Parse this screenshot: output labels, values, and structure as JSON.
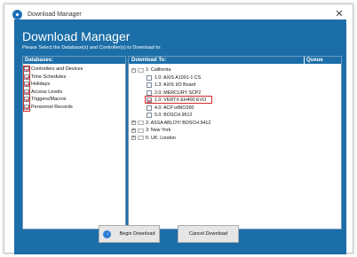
{
  "window": {
    "title": "Download Manager",
    "close_glyph": "✕"
  },
  "header": {
    "heading": "Download Manager",
    "subheading": "Please Select the Database(s) and Controller(s) to Download to:"
  },
  "databases": {
    "header": "Databases:",
    "items": [
      {
        "label": "Controllers and Devices",
        "checked": true
      },
      {
        "label": "Time Schedules",
        "checked": true
      },
      {
        "label": "Holidays",
        "checked": true
      },
      {
        "label": "Access Levels",
        "checked": true
      },
      {
        "label": "Triggers/Macros",
        "checked": true
      },
      {
        "label": "Personnel Records",
        "checked": true
      }
    ]
  },
  "download_to": {
    "header": "Download To:",
    "queue_header": "Queue",
    "tree": [
      {
        "label": "1: California",
        "level": 0,
        "expander": "−"
      },
      {
        "label": "1.0: AXIS A1001-1 CS",
        "level": 1,
        "checked": false
      },
      {
        "label": "1.3: AXIS I/O Board",
        "level": 1,
        "checked": false
      },
      {
        "label": "2.0: MERCURY SCP2",
        "level": 1,
        "checked": false
      },
      {
        "label": "1.0: VERTX EH400 EVO",
        "level": 1,
        "checked": true
      },
      {
        "label": "4.0: ACP inBIO260",
        "level": 1,
        "checked": false
      },
      {
        "label": "5.0: BOSCH 9512",
        "level": 1,
        "checked": false
      },
      {
        "label": "2: ASSA ABLOY/ BOSCH 9412",
        "level": 0,
        "expander": "+"
      },
      {
        "label": "3: New York",
        "level": 0,
        "expander": "+"
      },
      {
        "label": "5: UK: London",
        "level": 0,
        "expander": "+"
      }
    ]
  },
  "buttons": {
    "begin": "Begin Download",
    "cancel": "Cancel Download",
    "begin_icon": "download-icon"
  },
  "colors": {
    "accent": "#1b6ea8",
    "highlight": "#d82a2a"
  }
}
